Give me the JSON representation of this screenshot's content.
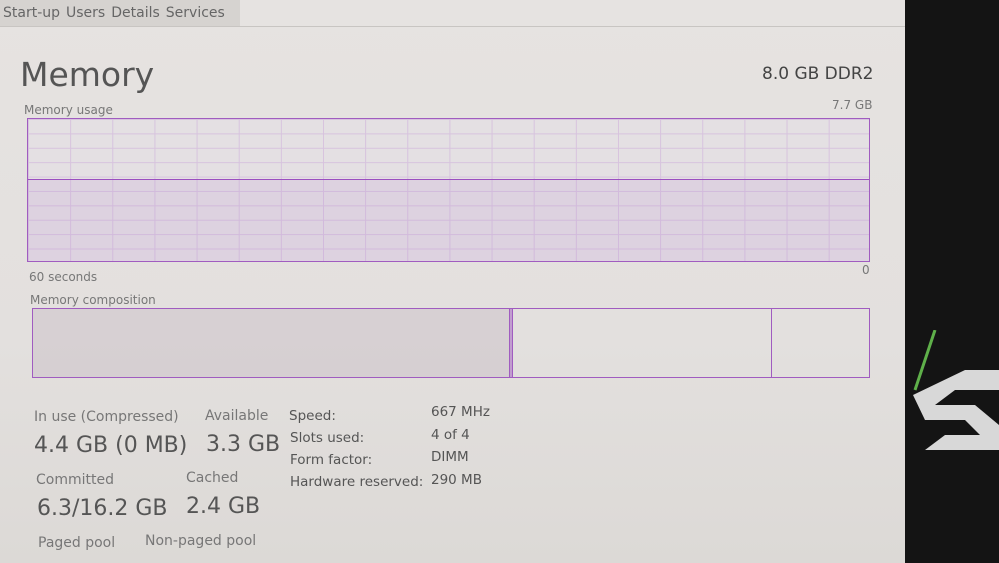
{
  "tabs": [
    "Start-up",
    "Users",
    "Details",
    "Services"
  ],
  "header": {
    "title": "Memory",
    "spec": "8.0 GB DDR2"
  },
  "usage_graph": {
    "label": "Memory usage",
    "max_label": "7.7 GB",
    "min_label": "0",
    "time_label": "60 seconds",
    "usage_fraction": 0.57,
    "color": "#9b4fc0"
  },
  "composition": {
    "label": "Memory composition",
    "segments": [
      {
        "name": "in-use",
        "fraction": 0.57
      },
      {
        "name": "modified",
        "fraction": 0.004
      },
      {
        "name": "standby",
        "fraction": 0.31
      },
      {
        "name": "free",
        "fraction": 0.116
      }
    ]
  },
  "stats": {
    "in_use_label": "In use (Compressed)",
    "in_use_value": "4.4 GB (0 MB)",
    "available_label": "Available",
    "available_value": "3.3 GB",
    "committed_label": "Committed",
    "committed_value": "6.3/16.2 GB",
    "cached_label": "Cached",
    "cached_value": "2.4 GB",
    "paged_label": "Paged pool",
    "nonpaged_label": "Non-paged pool"
  },
  "details": [
    {
      "key": "Speed:",
      "value": "667 MHz"
    },
    {
      "key": "Slots used:",
      "value": "4 of 4"
    },
    {
      "key": "Form factor:",
      "value": "DIMM"
    },
    {
      "key": "Hardware reserved:",
      "value": "290 MB"
    }
  ]
}
